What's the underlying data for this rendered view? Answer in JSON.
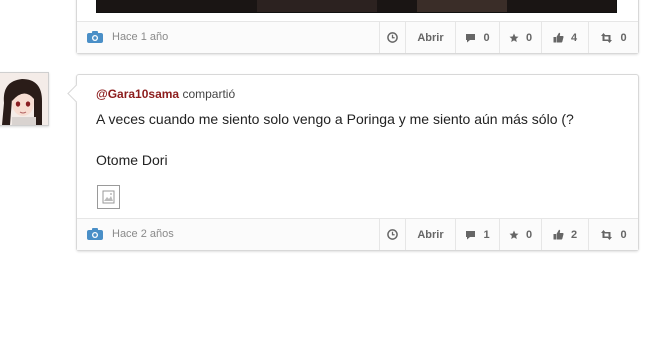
{
  "post1": {
    "time": "Hace 1 año",
    "open_label": "Abrir",
    "comments": "0",
    "favorites": "0",
    "likes": "4",
    "shares": "0"
  },
  "post2": {
    "user": "@Gara10sama",
    "action": "compartió",
    "text": "A veces cuando me siento solo vengo a Poringa y me siento aún más sólo (?",
    "caption": "Otome Dori",
    "time": "Hace 2 años",
    "open_label": "Abrir",
    "comments": "1",
    "favorites": "0",
    "likes": "2",
    "shares": "0"
  },
  "icons": {
    "camera": "camera-icon",
    "clock": "clock-icon",
    "comment": "comment-icon",
    "star": "star-icon",
    "thumbs": "thumbs-up-icon",
    "retweet": "share-icon"
  },
  "colors": {
    "username": "#8c1c1c",
    "camera": "#4a8fc7"
  }
}
